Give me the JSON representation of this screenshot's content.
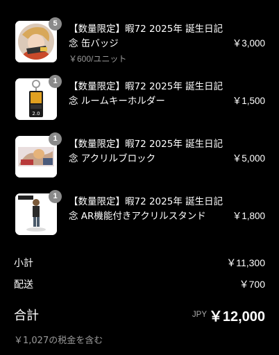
{
  "items": [
    {
      "title": "【数量限定】暇72 2025年 誕生日記念 缶バッジ",
      "quantity": "5",
      "unit_price": "￥600/ユニット",
      "price": "￥3,000",
      "thumb_icon": "tin-badge-illustration"
    },
    {
      "title": "【数量限定】暇72 2025年 誕生日記念 ルームキーホルダー",
      "quantity": "1",
      "price": "￥1,500",
      "thumb_icon": "room-key-holder-illustration",
      "thumb_text": "2.0"
    },
    {
      "title": "【数量限定】暇72 2025年 誕生日記念 アクリルブロック",
      "quantity": "1",
      "price": "￥5,000",
      "thumb_icon": "acrylic-block-illustration"
    },
    {
      "title": "【数量限定】暇72 2025年 誕生日記念 AR機能付きアクリルスタンド",
      "quantity": "1",
      "price": "￥1,800",
      "thumb_icon": "acrylic-stand-illustration"
    }
  ],
  "summary": {
    "subtotal_label": "小計",
    "subtotal_value": "￥11,300",
    "shipping_label": "配送",
    "shipping_value": "￥700",
    "total_label": "合計",
    "currency": "JPY",
    "total_value": "￥12,000",
    "tax_note": "￥1,027の税金を含む"
  }
}
